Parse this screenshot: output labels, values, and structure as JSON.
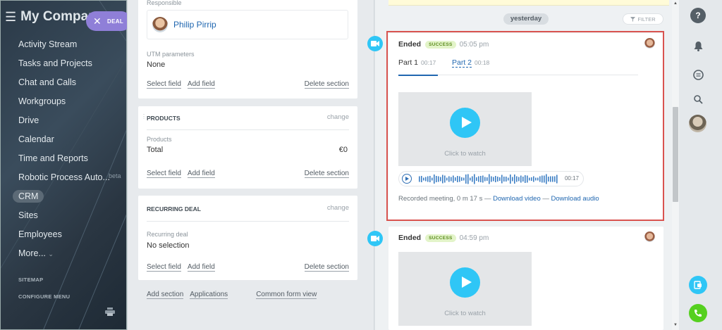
{
  "sidebar": {
    "company": "My Compan",
    "deal_pill": "DEAL",
    "items": [
      {
        "label": "Activity Stream"
      },
      {
        "label": "Tasks and Projects"
      },
      {
        "label": "Chat and Calls"
      },
      {
        "label": "Workgroups"
      },
      {
        "label": "Drive"
      },
      {
        "label": "Calendar"
      },
      {
        "label": "Time and Reports"
      },
      {
        "label": "Robotic Process Auto..."
      },
      {
        "label": "CRM"
      },
      {
        "label": "Sites"
      },
      {
        "label": "Employees"
      },
      {
        "label": "More..."
      }
    ],
    "beta": "beta",
    "sitemap": "SITEMAP",
    "configure": "CONFIGURE MENU"
  },
  "form": {
    "responsible_label": "Responsible",
    "responsible_name": "Philip Pirrip",
    "utm_label": "UTM parameters",
    "utm_value": "None",
    "select_field": "Select field",
    "add_field": "Add field",
    "delete_section": "Delete section",
    "change": "change",
    "products_title": "PRODUCTS",
    "products_label": "Products",
    "total_label": "Total",
    "total_value": "€0",
    "recurring_title": "RECURRING DEAL",
    "recurring_label": "Recurring deal",
    "recurring_value": "No selection",
    "add_section": "Add section",
    "applications": "Applications",
    "common_form_view": "Common form view"
  },
  "timeline": {
    "yesterday": "yesterday",
    "filter": "FILTER",
    "events": [
      {
        "status": "Ended",
        "badge": "SUCCESS",
        "time": "05:05 pm",
        "part1": "Part 1",
        "part1_dur": "00:17",
        "part2": "Part 2",
        "part2_dur": "00:18",
        "click_to_watch": "Click to watch",
        "audio_duration": "00:17",
        "recorded": "Recorded meeting, 0 m 17 s — ",
        "download_video": "Download video",
        "sep": " — ",
        "download_audio": "Download audio"
      },
      {
        "status": "Ended",
        "badge": "SUCCESS",
        "time": "04:59 pm",
        "click_to_watch": "Click to watch"
      }
    ]
  },
  "colors": {
    "accent": "#2fc6f6",
    "link": "#2067b0",
    "highlight_border": "#d9534f",
    "deal_pill": "#8f7fd8",
    "phone": "#55d01f"
  }
}
